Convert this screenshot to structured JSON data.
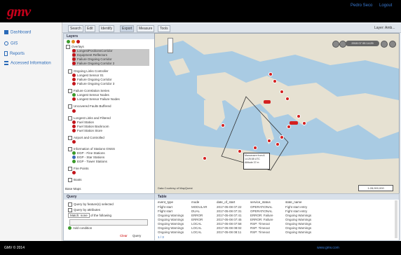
{
  "header": {
    "logo": "gmv",
    "user": "Pedro Seco",
    "logout": "Logout"
  },
  "sidebar": {
    "items": [
      {
        "label": "Dashboard",
        "icon": "grid-icon"
      },
      {
        "label": "GIS",
        "icon": "globe-icon"
      },
      {
        "label": "Reports",
        "icon": "document-icon"
      },
      {
        "label": "Accessed Information",
        "icon": "list-icon"
      }
    ]
  },
  "toolbar": {
    "buttons": [
      "Search",
      "Edit",
      "Identify",
      "Export",
      "Measure",
      "Tools"
    ],
    "right_text": "Layer: Amb..."
  },
  "layers": {
    "title": "Layers",
    "groups": [
      {
        "label": "Overlays",
        "items": [
          "LongestPositionsCorridor",
          "Equipment Reflectors",
          "Failure Ongoing Corridor",
          "Failure Ongoing Corridor 2"
        ]
      },
      {
        "label": "Ongoing Links Controller",
        "items": [
          "Longest Sensor 01",
          "Failure Ongoing Corridor",
          "Failure Ongoing Corridor 3"
        ]
      },
      {
        "label": "Failure Correlation Series",
        "items": [
          "Longest Sensor Nodes",
          "Longest Sensor Failure Nodes"
        ]
      },
      {
        "label": "Uncovered Faults Buffered",
        "items": []
      },
      {
        "label": "Longest Links and Filtered",
        "items": [
          "Fuel Station",
          "Fuel Station Backroom",
          "Fuel Station Store"
        ]
      },
      {
        "label": "Airport and Controlled",
        "items": []
      },
      {
        "label": "Information of Stations GNSS",
        "items": [
          "EGP - Fine Stations",
          "EGP - Star Stations",
          "EGP - Tower Stations"
        ]
      },
      {
        "label": "Fire Points",
        "items": []
      },
      {
        "label": "Boats",
        "items": []
      }
    ],
    "base": "Base Maps"
  },
  "map": {
    "attribution": "Data Courtesy of MapQuest",
    "popup": [
      "Manoeuvre from A",
      "14:25:08 UTC",
      "Altitude 37 m"
    ],
    "time_label": "2015 07 05 14:25",
    "scale_label": "1:28,000,000"
  },
  "query": {
    "title": "Query",
    "opt1": "Query by feature(s) selected",
    "opt2": "Query by attributes",
    "match_label": "Match: none",
    "match_suffix": "of the following",
    "add_condition": "Add condition",
    "run": "Query",
    "clear": "Clear"
  },
  "table": {
    "title": "Table",
    "columns": [
      "event_type",
      "mode",
      "date_of_start",
      "service_status",
      "state_name"
    ],
    "rows": [
      [
        "Flight start",
        "MODULAR",
        "2017-05-08 07:22",
        "OPERATIONAL",
        "Fight start entry"
      ],
      [
        "Flight start",
        "DUAL",
        "2017-05-08 07:31",
        "OPERATIONAL",
        "Fight start entry"
      ],
      [
        "Ongoing Warnings",
        "ERROR",
        "2017-05-08 07:41",
        "ERROR: Failure",
        "Ongoing Warnings"
      ],
      [
        "Ongoing Warnings",
        "ERROR",
        "2017-05-08 07:45",
        "ERROR: Failure",
        "Ongoing Warnings"
      ],
      [
        "Ongoing Warnings",
        "LOCAL",
        "2017-05-08 07:58",
        "RSP: Timeout",
        "Ongoing Warnings"
      ],
      [
        "Ongoing Warnings",
        "LOCAL",
        "2017-05-08 08:02",
        "RSP: Timeout",
        "Ongoing Warnings"
      ],
      [
        "Ongoing Warnings",
        "LOCAL",
        "2017-05-08 08:11",
        "RSP: Timeout",
        "Ongoing Warnings"
      ]
    ],
    "pager": "1 / 3"
  },
  "footer": {
    "copyright": "GMV © 2014",
    "link": "www.gmv.com"
  }
}
